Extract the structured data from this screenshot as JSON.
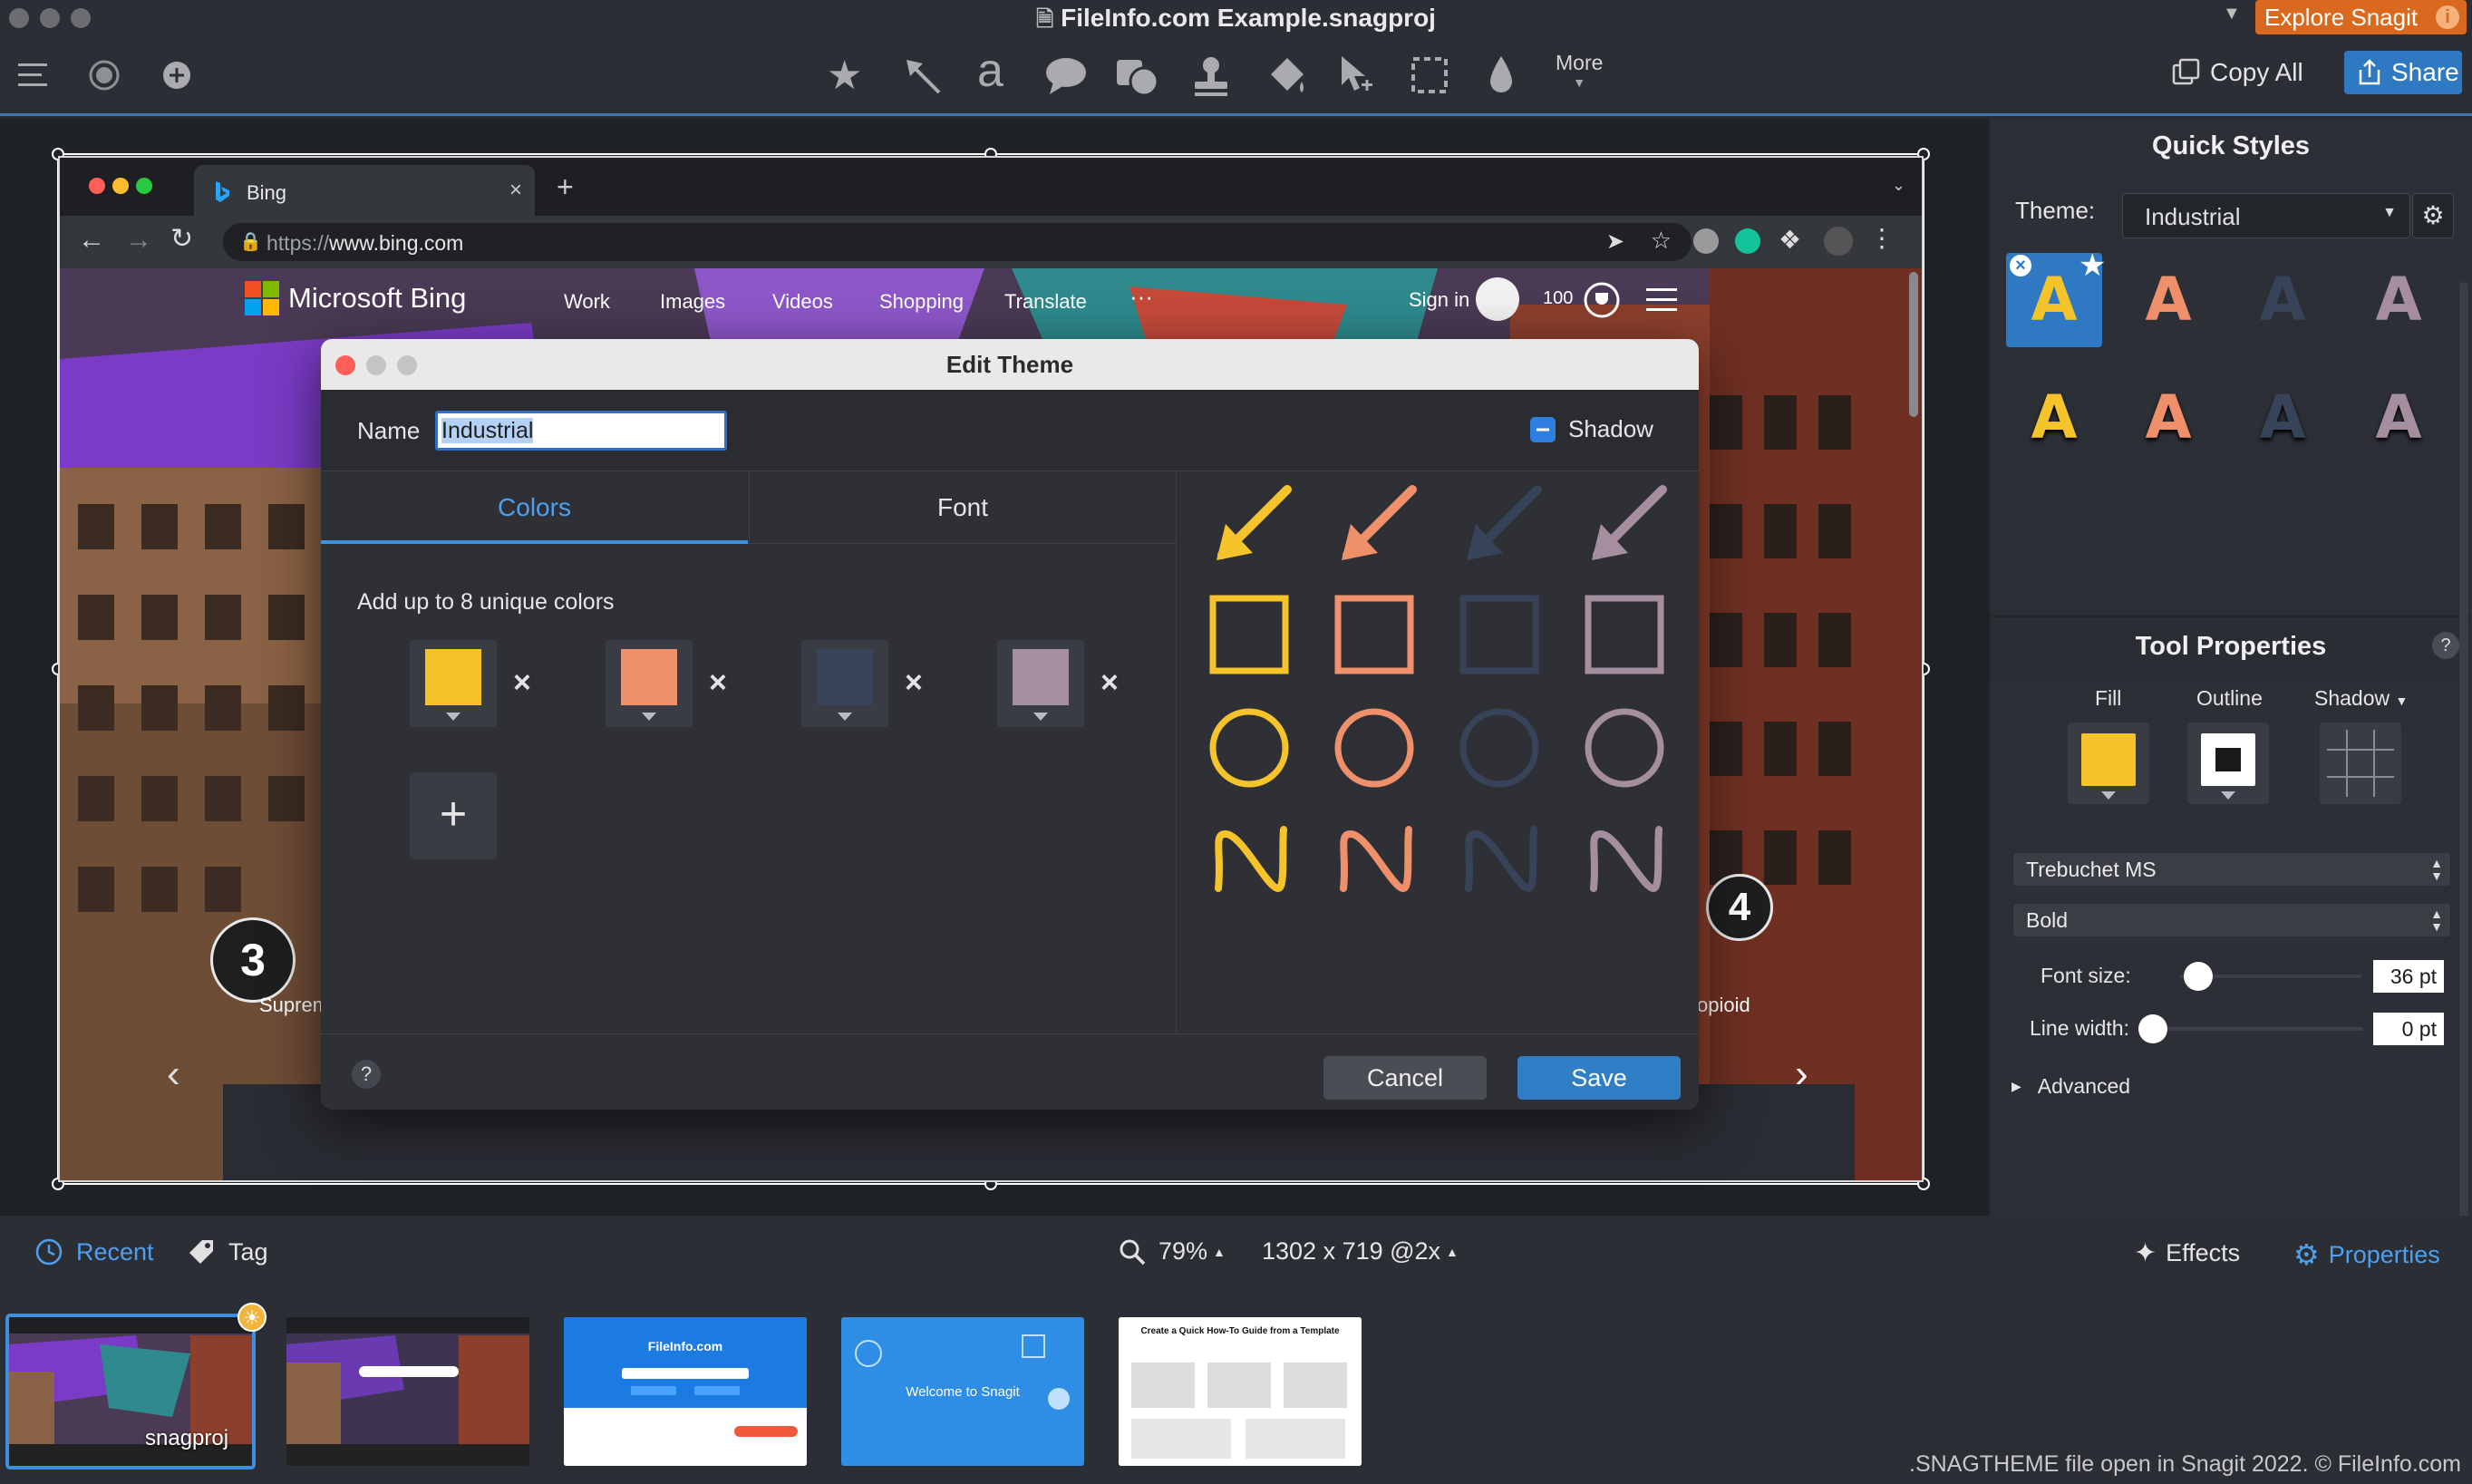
{
  "window": {
    "title": "FileInfo.com Example.snagproj",
    "explore_label": "Explore Snagit",
    "info_glyph": "i"
  },
  "toolbar": {
    "tools": [
      "favorites-star-icon",
      "arrow-icon",
      "text-icon",
      "callout-icon",
      "shape-icon",
      "stamp-icon",
      "fill-icon",
      "move-icon",
      "selection-icon",
      "blur-icon"
    ],
    "text_glyph": "a",
    "more_label": "More",
    "copy_all_label": "Copy All",
    "share_label": "Share"
  },
  "browser": {
    "tab_title": "Bing",
    "url_prefix": "https://",
    "url_domain": "www.bing.com",
    "bing": {
      "logo_text": "Microsoft Bing",
      "nav": [
        "Work",
        "Images",
        "Videos",
        "Shopping",
        "Translate",
        "···"
      ],
      "sign_in": "Sign in",
      "points": "100",
      "carousel_left_num": "3",
      "carousel_left_text": "Suprem",
      "carousel_right_num": "4",
      "carousel_right_text": "opioid"
    }
  },
  "dialog": {
    "title": "Edit Theme",
    "name_label": "Name",
    "name_value": "Industrial",
    "shadow_label": "Shadow",
    "tabs": [
      "Colors",
      "Font"
    ],
    "active_tab": "Colors",
    "colors_hint": "Add up to 8 unique colors",
    "colors": [
      "#f5c42a",
      "#f0906a",
      "#364358",
      "#a58f9f"
    ],
    "remove_glyph": "×",
    "add_glyph": "+",
    "help_glyph": "?",
    "cancel_label": "Cancel",
    "save_label": "Save"
  },
  "quick_styles": {
    "heading": "Quick Styles",
    "theme_label": "Theme:",
    "theme_value": "Industrial",
    "glyph": "A"
  },
  "tool_properties": {
    "heading": "Tool Properties",
    "help_glyph": "?",
    "fill_label": "Fill",
    "outline_label": "Outline",
    "shadow_label": "Shadow",
    "fill_color": "#f5c42a",
    "font_family": "Trebuchet MS",
    "font_weight": "Bold",
    "font_size_label": "Font size:",
    "font_size_value": "36 pt",
    "line_width_label": "Line width:",
    "line_width_value": "0 pt",
    "advanced_label": "Advanced"
  },
  "bottom": {
    "recent_label": "Recent",
    "tag_label": "Tag",
    "zoom": "79%",
    "dimensions": "1302 x 719 @2x",
    "effects_label": "Effects",
    "properties_label": "Properties"
  },
  "thumbnails": {
    "first_label": "snagproj",
    "fileinfo_title": "FileInfo.com",
    "welcome_title": "Welcome to Snagit",
    "howto_title": "Create a Quick How-To Guide from a Template"
  },
  "caption": ".SNAGTHEME file open in Snagit 2022. © FileInfo.com"
}
